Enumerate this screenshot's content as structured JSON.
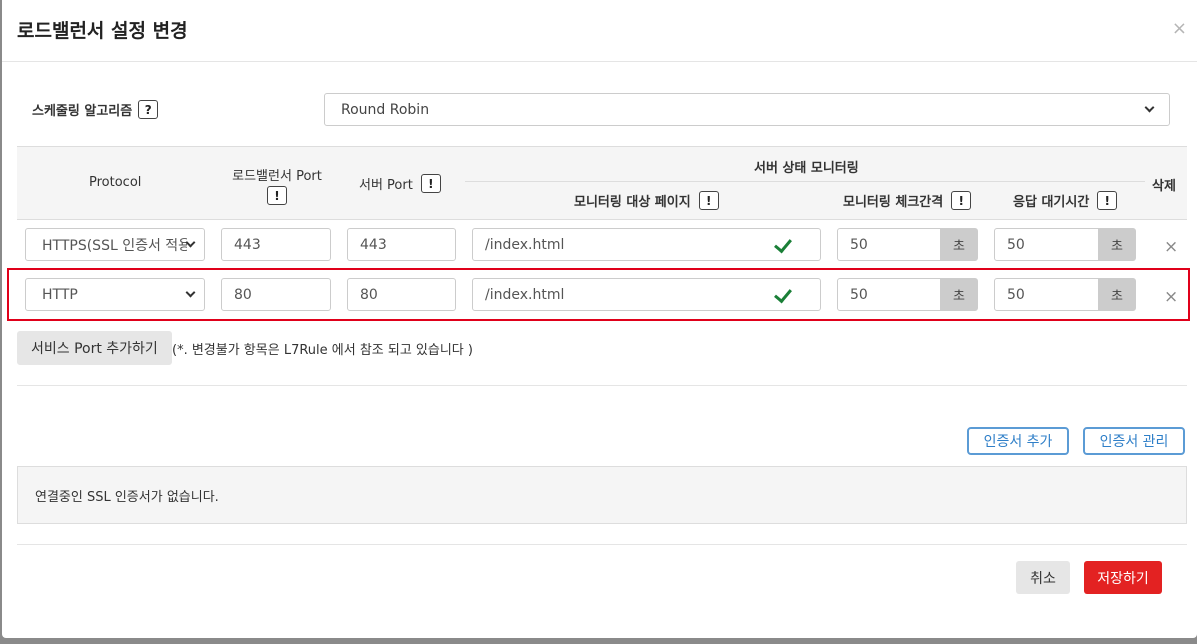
{
  "modal": {
    "title": "로드밸런서 설정 변경",
    "close": "×"
  },
  "scheduling": {
    "label": "스케줄링 알고리즘",
    "help": "?",
    "value": "Round Robin"
  },
  "table": {
    "headers": {
      "protocol": "Protocol",
      "lb_port": "로드밸런서 Port",
      "server_port": "서버 Port",
      "monitoring": "서버 상태 모니터링",
      "monitor_page": "모니터링 대상 페이지",
      "check_interval": "모니터링 체크간격",
      "response_wait": "응답 대기시간",
      "delete": "삭제",
      "warn": "!"
    },
    "rows": [
      {
        "protocol": "HTTPS(SSL 인증서 적용",
        "lb_port": "443",
        "server_port": "443",
        "page": "/index.html",
        "interval": "50",
        "interval_unit": "초",
        "wait": "50",
        "wait_unit": "초",
        "delete": "×"
      },
      {
        "protocol": "HTTP",
        "lb_port": "80",
        "server_port": "80",
        "page": "/index.html",
        "interval": "50",
        "interval_unit": "초",
        "wait": "50",
        "wait_unit": "초",
        "delete": "×"
      }
    ]
  },
  "add_port_button": "서비스 Port 추가하기",
  "note": "(*. 변경불가 항목은 L7Rule 에서 참조 되고 있습니다 )",
  "cert": {
    "add_button": "인증서 추가",
    "manage_button": "인증서 관리",
    "empty_message": "연결중인 SSL 인증서가 없습니다."
  },
  "footer": {
    "cancel": "취소",
    "save": "저장하기"
  },
  "colors": {
    "accent_red": "#e32222",
    "outline_blue": "#5b9bd5",
    "check_green": "#1a7f37",
    "highlight_red": "#e0001a"
  }
}
